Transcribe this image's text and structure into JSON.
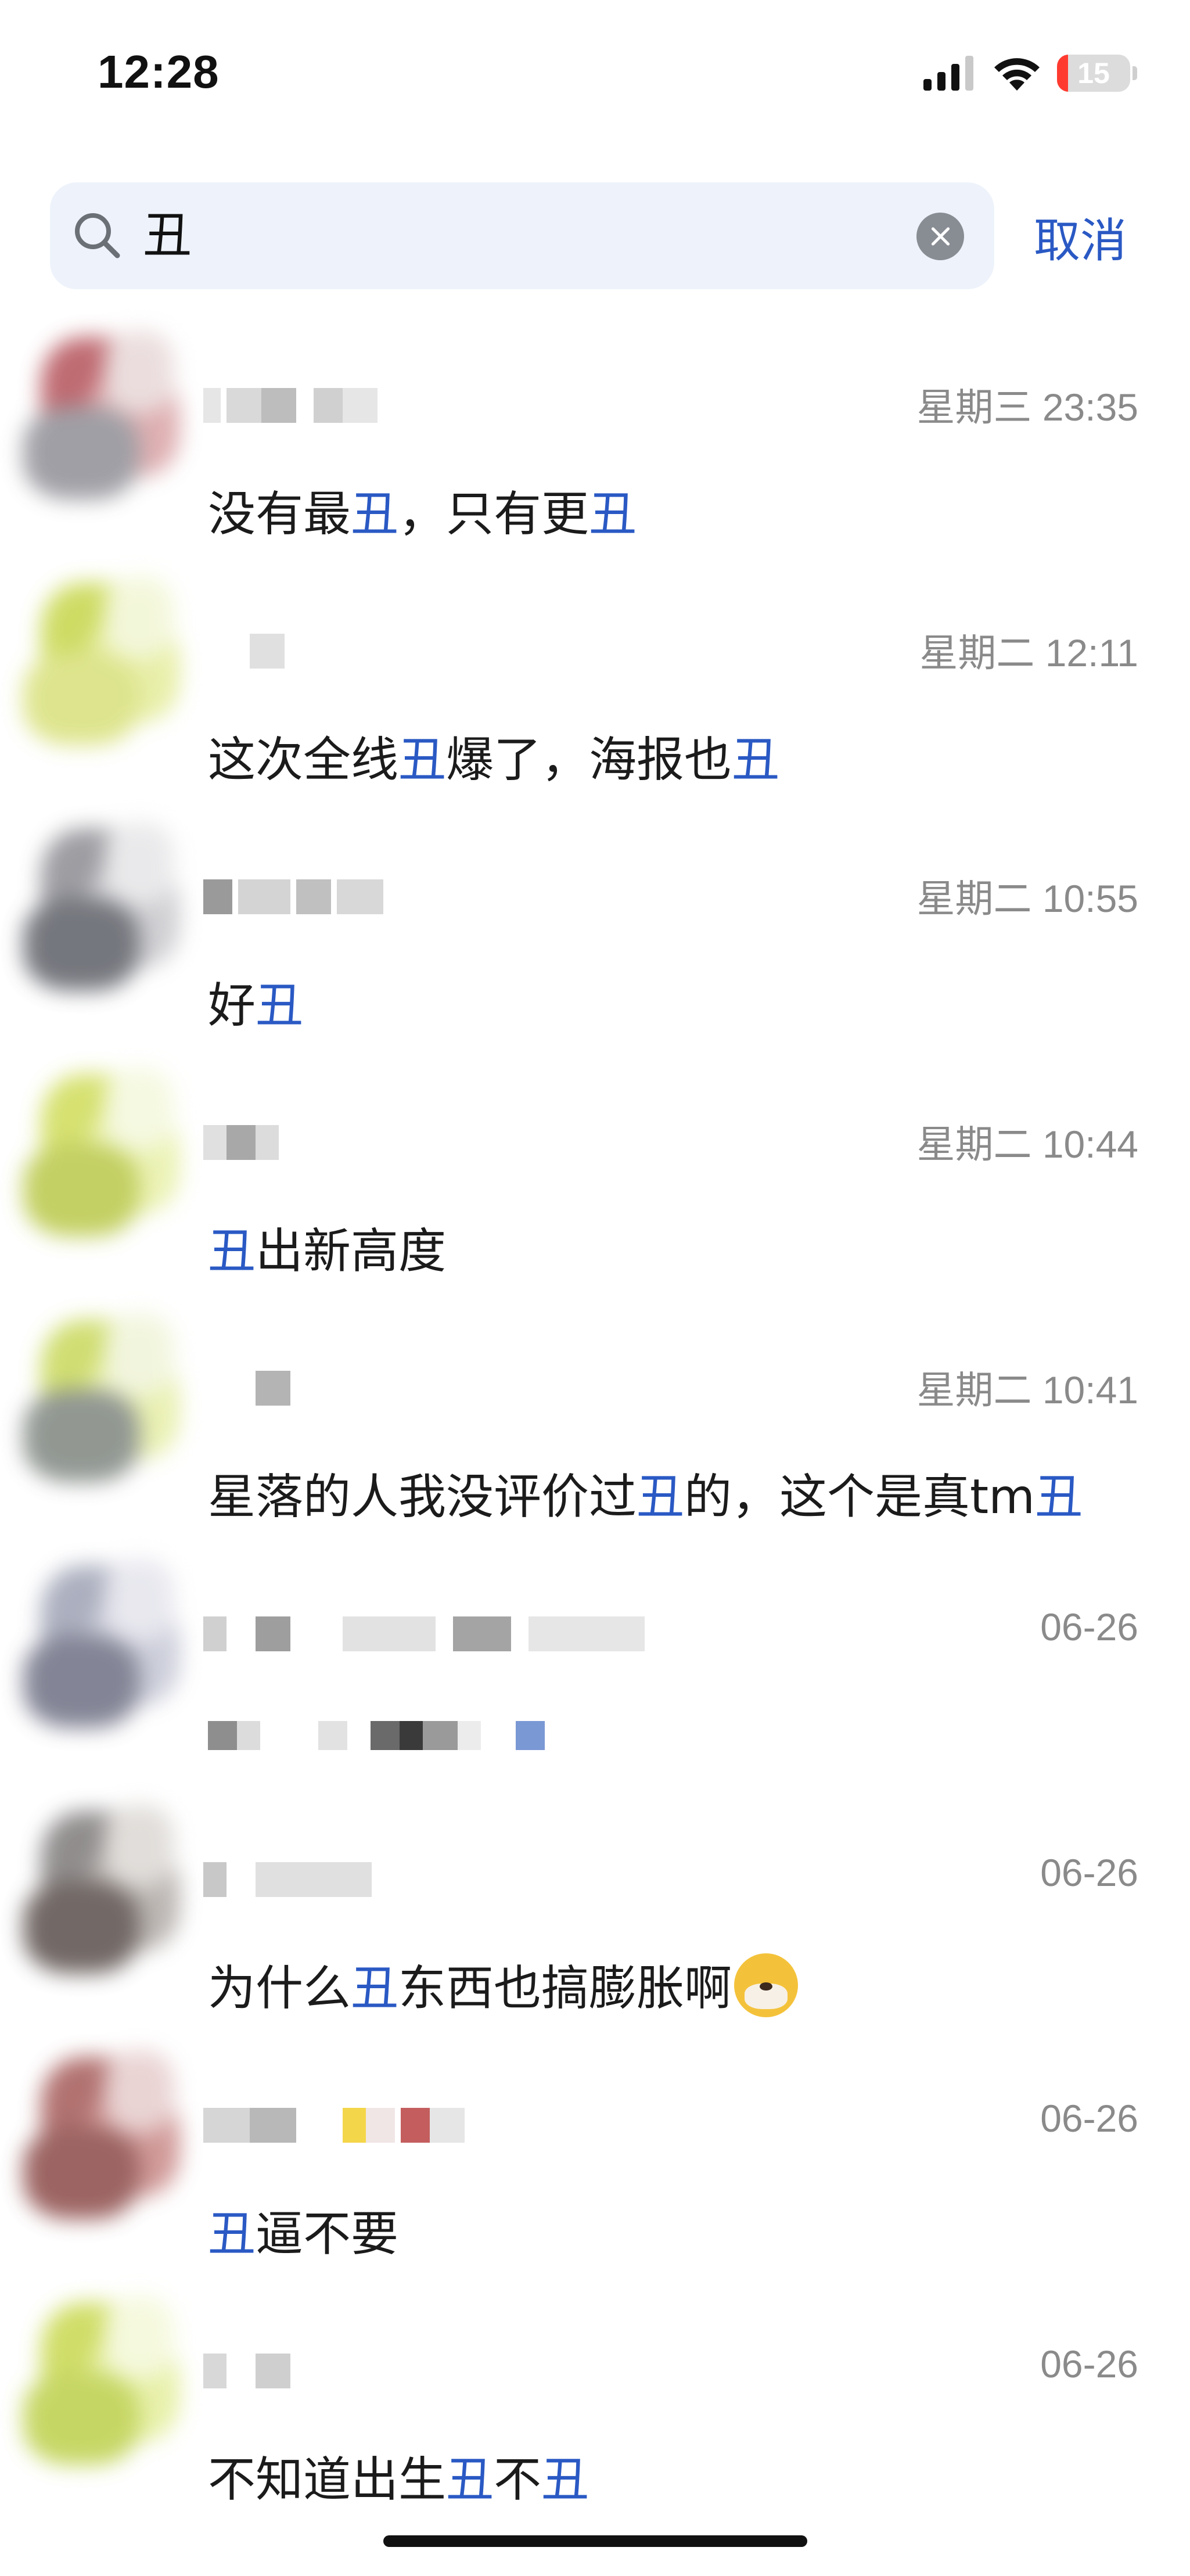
{
  "status_bar": {
    "time": "12:28",
    "battery": "15",
    "battery_level": 0.15
  },
  "search": {
    "query": "丑",
    "cancel_label": "取消"
  },
  "results": [
    {
      "time": "星期三 23:35",
      "segments": [
        {
          "t": "没有最",
          "hl": false
        },
        {
          "t": "丑",
          "hl": true
        },
        {
          "t": "，只有更",
          "hl": false
        },
        {
          "t": "丑",
          "hl": true
        }
      ]
    },
    {
      "time": "星期二 12:11",
      "segments": [
        {
          "t": "这次全线",
          "hl": false
        },
        {
          "t": "丑",
          "hl": true
        },
        {
          "t": "爆了，海报也",
          "hl": false
        },
        {
          "t": "丑",
          "hl": true
        }
      ]
    },
    {
      "time": "星期二 10:55",
      "segments": [
        {
          "t": "好",
          "hl": false
        },
        {
          "t": "丑",
          "hl": true
        }
      ]
    },
    {
      "time": "星期二 10:44",
      "segments": [
        {
          "t": "丑",
          "hl": true
        },
        {
          "t": "出新高度",
          "hl": false
        }
      ]
    },
    {
      "time": "星期二 10:41",
      "segments": [
        {
          "t": "星落的人我没评价过",
          "hl": false
        },
        {
          "t": "丑",
          "hl": true
        },
        {
          "t": "的，这个是真tm",
          "hl": false
        },
        {
          "t": "丑",
          "hl": true
        }
      ]
    },
    {
      "time": "06-26",
      "segments": []
    },
    {
      "time": "06-26",
      "segments": [
        {
          "t": "为什么",
          "hl": false
        },
        {
          "t": "丑",
          "hl": true
        },
        {
          "t": "东西也搞膨胀啊",
          "hl": false
        }
      ],
      "emoji": "dog-emoji"
    },
    {
      "time": "06-26",
      "segments": [
        {
          "t": "丑",
          "hl": true
        },
        {
          "t": "逼不要",
          "hl": false
        }
      ]
    },
    {
      "time": "06-26",
      "segments": [
        {
          "t": "不知道出生",
          "hl": false
        },
        {
          "t": "丑",
          "hl": true
        },
        {
          "t": "不",
          "hl": false
        },
        {
          "t": "丑",
          "hl": true
        }
      ]
    }
  ],
  "colors": {
    "highlight": "#2a59c4",
    "time": "#8a8a8a",
    "search_bg": "#eef3fb"
  }
}
